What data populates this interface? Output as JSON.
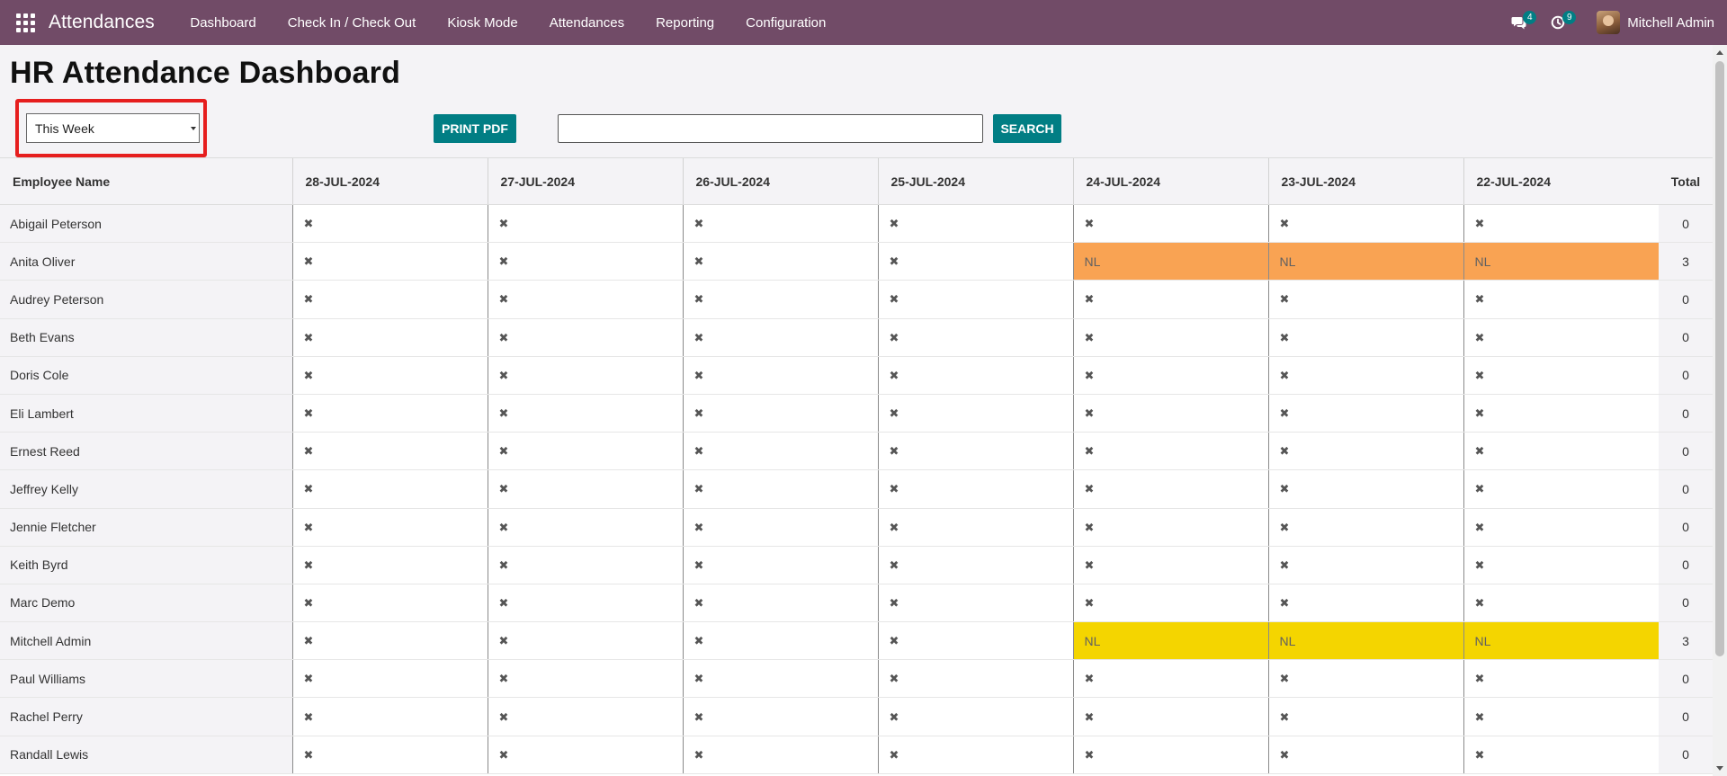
{
  "app": {
    "title": "Attendances",
    "menu": [
      "Dashboard",
      "Check In / Check Out",
      "Kiosk Mode",
      "Attendances",
      "Reporting",
      "Configuration"
    ],
    "messages_badge": "4",
    "activities_badge": "9",
    "user_name": "Mitchell Admin"
  },
  "page": {
    "title": "HR Attendance Dashboard",
    "period_value": "This Week",
    "print_label": "PRINT PDF",
    "search_value": "",
    "search_label": "SEARCH"
  },
  "colors": {
    "navbar": "#714b67",
    "accent": "#017e84",
    "leave_orange": "#f9a353",
    "leave_yellow": "#f4d500",
    "highlight_red": "#e61e1e"
  },
  "table": {
    "headers": [
      "Employee Name",
      "28-JUL-2024",
      "27-JUL-2024",
      "26-JUL-2024",
      "25-JUL-2024",
      "24-JUL-2024",
      "23-JUL-2024",
      "22-JUL-2024",
      "Total"
    ],
    "absent_symbol": "✖",
    "rows": [
      {
        "name": "Abigail Peterson",
        "cells": [
          "x",
          "x",
          "x",
          "x",
          "x",
          "x",
          "x"
        ],
        "total": "0"
      },
      {
        "name": "Anita Oliver",
        "cells": [
          "x",
          "x",
          "x",
          "x",
          "NL",
          "NL",
          "NL"
        ],
        "leave_color": "#f9a353",
        "total": "3"
      },
      {
        "name": "Audrey Peterson",
        "cells": [
          "x",
          "x",
          "x",
          "x",
          "x",
          "x",
          "x"
        ],
        "total": "0"
      },
      {
        "name": "Beth Evans",
        "cells": [
          "x",
          "x",
          "x",
          "x",
          "x",
          "x",
          "x"
        ],
        "total": "0"
      },
      {
        "name": "Doris Cole",
        "cells": [
          "x",
          "x",
          "x",
          "x",
          "x",
          "x",
          "x"
        ],
        "total": "0"
      },
      {
        "name": "Eli Lambert",
        "cells": [
          "x",
          "x",
          "x",
          "x",
          "x",
          "x",
          "x"
        ],
        "total": "0"
      },
      {
        "name": "Ernest Reed",
        "cells": [
          "x",
          "x",
          "x",
          "x",
          "x",
          "x",
          "x"
        ],
        "total": "0"
      },
      {
        "name": "Jeffrey Kelly",
        "cells": [
          "x",
          "x",
          "x",
          "x",
          "x",
          "x",
          "x"
        ],
        "total": "0"
      },
      {
        "name": "Jennie Fletcher",
        "cells": [
          "x",
          "x",
          "x",
          "x",
          "x",
          "x",
          "x"
        ],
        "total": "0"
      },
      {
        "name": "Keith Byrd",
        "cells": [
          "x",
          "x",
          "x",
          "x",
          "x",
          "x",
          "x"
        ],
        "total": "0"
      },
      {
        "name": "Marc Demo",
        "cells": [
          "x",
          "x",
          "x",
          "x",
          "x",
          "x",
          "x"
        ],
        "total": "0"
      },
      {
        "name": "Mitchell Admin",
        "cells": [
          "x",
          "x",
          "x",
          "x",
          "NL",
          "NL",
          "NL"
        ],
        "leave_color": "#f4d500",
        "total": "3"
      },
      {
        "name": "Paul Williams",
        "cells": [
          "x",
          "x",
          "x",
          "x",
          "x",
          "x",
          "x"
        ],
        "total": "0"
      },
      {
        "name": "Rachel Perry",
        "cells": [
          "x",
          "x",
          "x",
          "x",
          "x",
          "x",
          "x"
        ],
        "total": "0"
      },
      {
        "name": "Randall Lewis",
        "cells": [
          "x",
          "x",
          "x",
          "x",
          "x",
          "x",
          "x"
        ],
        "total": "0"
      }
    ]
  }
}
